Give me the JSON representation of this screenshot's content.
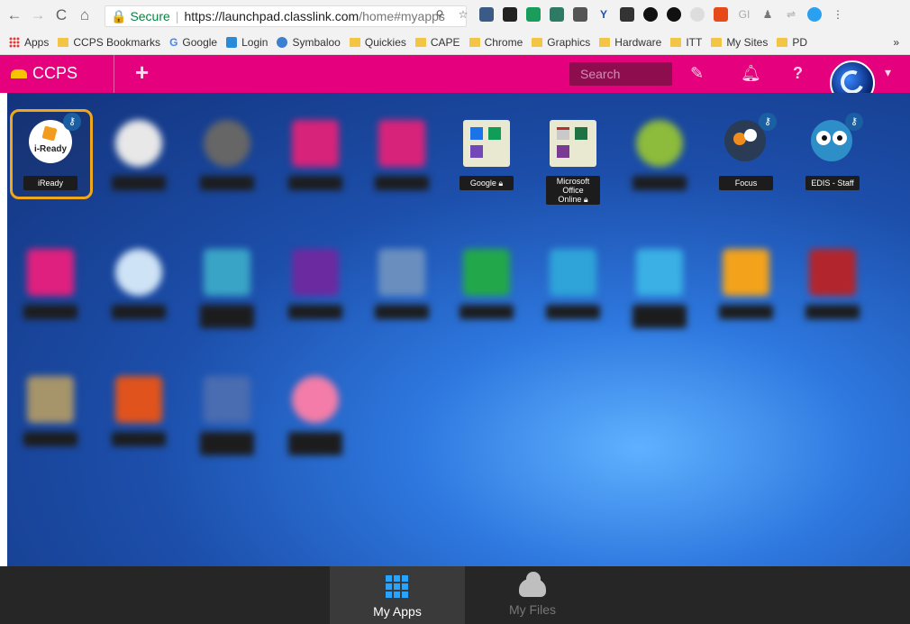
{
  "browser": {
    "secure_label": "Secure",
    "url_host": "https://launchpad.classlink.com",
    "url_path": "/home#myapps"
  },
  "bookmarks": [
    {
      "label": "Apps",
      "icon": "apps-grid-icon"
    },
    {
      "label": "CCPS Bookmarks",
      "icon": "folder-icon"
    },
    {
      "label": "Google",
      "icon": "google-icon"
    },
    {
      "label": "Login",
      "icon": "login-icon"
    },
    {
      "label": "Symbaloo",
      "icon": "symbaloo-icon"
    },
    {
      "label": "Quickies",
      "icon": "folder-icon"
    },
    {
      "label": "CAPE",
      "icon": "folder-icon"
    },
    {
      "label": "Chrome",
      "icon": "folder-icon"
    },
    {
      "label": "Graphics",
      "icon": "folder-icon"
    },
    {
      "label": "Hardware",
      "icon": "folder-icon"
    },
    {
      "label": "ITT",
      "icon": "folder-icon"
    },
    {
      "label": "My Sites",
      "icon": "folder-icon"
    },
    {
      "label": "PD",
      "icon": "folder-icon"
    }
  ],
  "bookmarks_more": "»",
  "header": {
    "brand": "CCPS",
    "search_placeholder": "Search",
    "accent_color": "#e5007e"
  },
  "apps_visible": {
    "iready": "iReady",
    "google": "Google",
    "office_line1": "Microsoft",
    "office_line2": "Office",
    "office_line3": "Online",
    "focus": "Focus",
    "edis": "EDIS - Staff"
  },
  "bottom_tabs": {
    "my_apps": "My Apps",
    "my_files": "My Files"
  }
}
